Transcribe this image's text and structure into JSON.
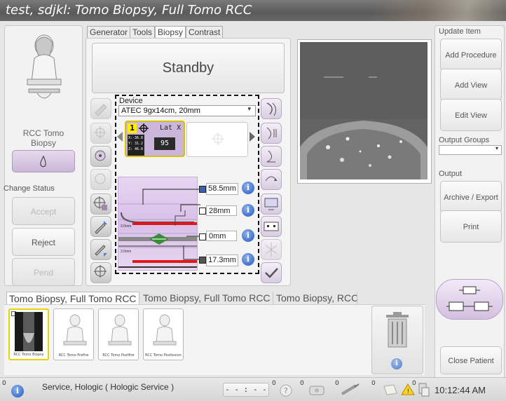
{
  "window": {
    "title": "test, sdjkl:  Tomo Biopsy, Full Tomo RCC"
  },
  "left": {
    "view_label": "RCC Tomo Biopsy",
    "change_status_label": "Change Status",
    "buttons": {
      "accept": "Accept",
      "reject": "Reject",
      "pend": "Pend"
    }
  },
  "tabs": [
    {
      "label": "Generator",
      "active": false
    },
    {
      "label": "Tools",
      "active": false
    },
    {
      "label": "Biopsy",
      "active": true
    },
    {
      "label": "Contrast",
      "active": false
    }
  ],
  "biopsy": {
    "status": "Standby",
    "device_label": "Device",
    "device_value": "ATEC 9gx14cm, 20mm",
    "target": {
      "number": "1",
      "lat": "Lat X",
      "x": "X:-36.8",
      "y": "Y: 31.2",
      "z": "Z: 46.0",
      "value": "95"
    },
    "measurements": [
      "58.5mm",
      "28mm",
      "0mm",
      "17.3mm"
    ],
    "diagram_labels": [
      "3.0mm",
      "3.0mm"
    ]
  },
  "right": {
    "update_item_label": "Update Item",
    "add_procedure": "Add Procedure",
    "add_view": "Add View",
    "edit_view": "Edit View",
    "output_groups_label": "Output Groups",
    "output_label": "Output",
    "archive_export": "Archive / Export",
    "print": "Print",
    "close_patient": "Close Patient"
  },
  "procedure_tabs": [
    {
      "label": "Tomo Biopsy, Full Tomo RCC",
      "active": true
    },
    {
      "label": "Tomo Biopsy, Full Tomo RCC",
      "active": false
    },
    {
      "label": "Tomo Biopsy, RCC",
      "active": false
    }
  ],
  "thumbnails": [
    {
      "label": "RCC Tomo Biopsy"
    },
    {
      "label": "RCC Tomo Prefire"
    },
    {
      "label": "RCC Tomo Postfire"
    },
    {
      "label": "RCC Tomo Postlesion"
    }
  ],
  "statusbar": {
    "service_text": "Service, Hologic ( Hologic Service )",
    "timer": "- - : - -",
    "time": "10:12:44 AM",
    "counts": [
      "0",
      "0",
      "0",
      "0",
      "0",
      "0"
    ]
  },
  "colors": {
    "accent_purple": "#d9c3e7",
    "target_yellow": "#ffec00",
    "info_blue": "#2a63c9",
    "titlebar": "#6b6b6b"
  }
}
